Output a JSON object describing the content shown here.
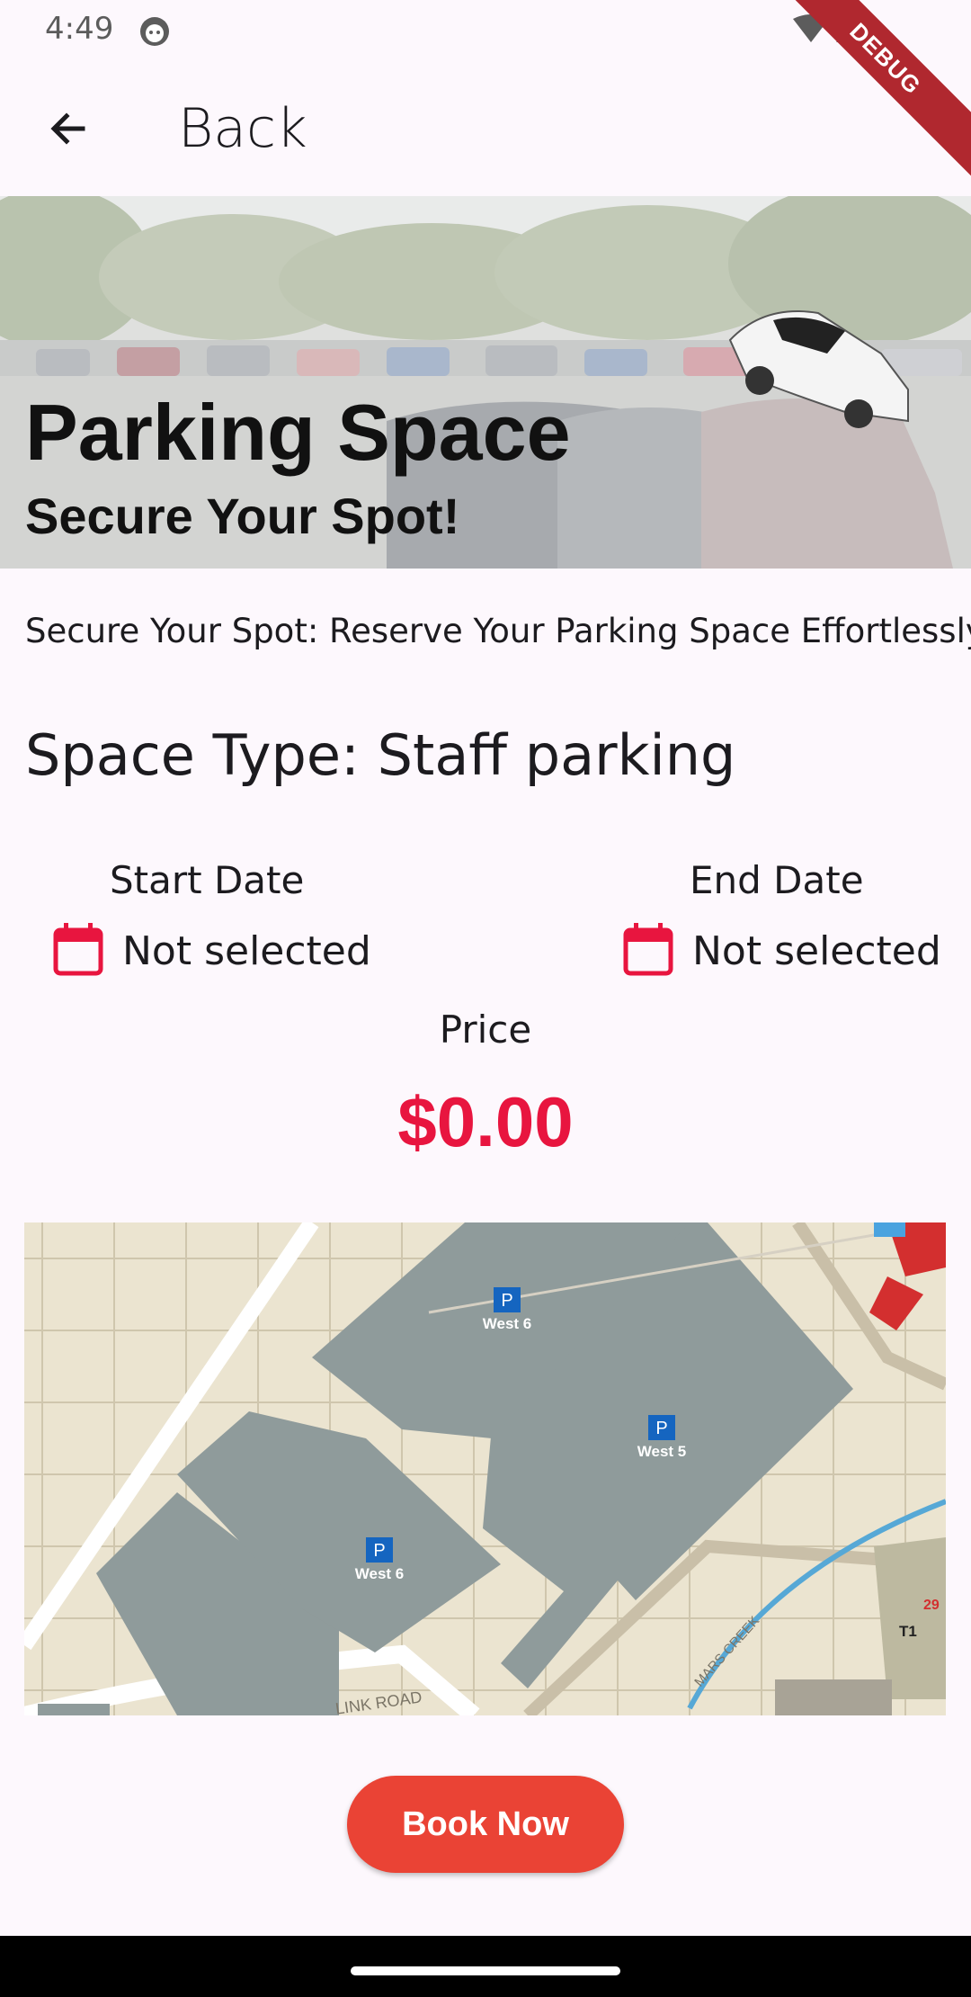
{
  "status_bar": {
    "time": "4:49"
  },
  "debug_banner": "DEBUG",
  "app_bar": {
    "back_label": "Back"
  },
  "hero": {
    "title": "Parking Space",
    "subtitle": "Secure Your Spot!"
  },
  "tagline": "Secure Your Spot: Reserve Your Parking Space Effortlessly.",
  "space_type": "Space Type: Staff parking",
  "dates": {
    "start": {
      "label": "Start Date",
      "value": "Not selected"
    },
    "end": {
      "label": "End Date",
      "value": "Not selected"
    }
  },
  "price": {
    "label": "Price",
    "value": "$0.00"
  },
  "map": {
    "parking_lots": [
      "West 6",
      "West 5",
      "West 6"
    ],
    "parking_symbol": "P",
    "roads": [
      "LINK ROAD",
      "MARS CREEK"
    ],
    "marker": "T1",
    "marker_number": "29"
  },
  "actions": {
    "book_now": "Book Now"
  },
  "colors": {
    "accent": "#e8153f",
    "button": "#ea4335",
    "map_bg": "#ebe4d0",
    "lot": "#8f9b9b"
  }
}
